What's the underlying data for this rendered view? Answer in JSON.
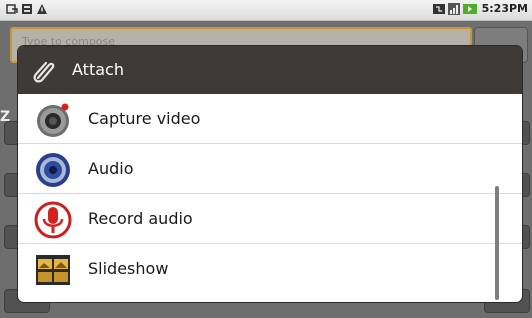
{
  "status_bar": {
    "time": "5:23PM",
    "left_icons": [
      "usb-icon",
      "sd-card-icon",
      "warning-icon"
    ],
    "right_icons": [
      "data-sync-icon",
      "signal-icon",
      "battery-icon"
    ]
  },
  "background": {
    "compose_placeholder": "Type to compose"
  },
  "dialog": {
    "title": "Attach",
    "title_icon": "paperclip-icon",
    "items": [
      {
        "label": "Capture video",
        "icon": "video-camera-icon"
      },
      {
        "label": "Audio",
        "icon": "speaker-icon"
      },
      {
        "label": "Record audio",
        "icon": "microphone-icon"
      },
      {
        "label": "Slideshow",
        "icon": "slideshow-icon"
      }
    ]
  },
  "colors": {
    "title_bar": "#3d3a37",
    "list_background": "#ffffff",
    "compose_border": "#c79636",
    "dim_overlay": "#6e6e6e"
  }
}
